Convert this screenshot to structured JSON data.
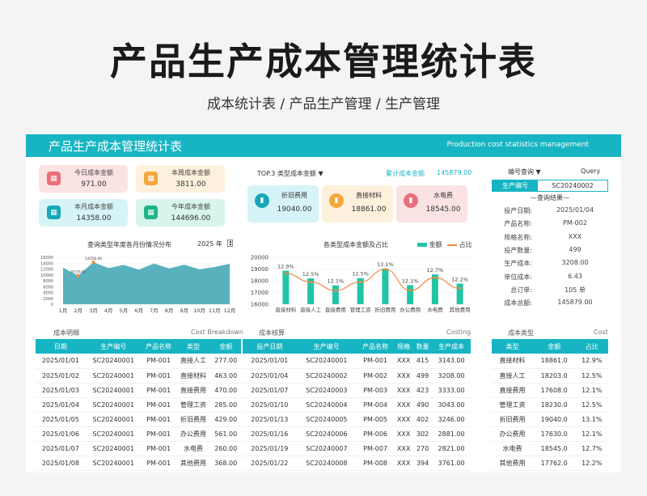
{
  "title": "产品生产成本管理统计表",
  "subtitle": "成本统计表 / 产品生产管理 / 生产管理",
  "banner": {
    "title": "产品生产成本管理统计表",
    "en": "Production cost statistics management"
  },
  "kpis": [
    {
      "label": "今日成本金额",
      "value": "971.00",
      "bg": "#fbe3e4",
      "icon_bg": "#e8707a",
      "icon": "calendar-icon"
    },
    {
      "label": "本周成本金额",
      "value": "3811.00",
      "bg": "#fdf0dd",
      "icon_bg": "#f5a83b",
      "icon": "calendar-icon"
    },
    {
      "label": "本月成本金额",
      "value": "14358.00",
      "bg": "#d6f4f7",
      "icon_bg": "#19a7b7",
      "icon": "chart-icon"
    },
    {
      "label": "今年成本金额",
      "value": "144696.00",
      "bg": "#d7f5ec",
      "icon_bg": "#1fb58a",
      "icon": "chart-icon"
    }
  ],
  "area_chart_header": {
    "label": "查询类型年度各月份情况分布",
    "year": "2025 年"
  },
  "top3_header": {
    "label": "TOP.3 类型成本金额 ▼",
    "total_label": "累计成本金额",
    "total_value": "145879.00"
  },
  "top3": [
    {
      "label": "折旧费用",
      "value": "19040.00",
      "bg": "#d6f4f7",
      "icon_bg": "#19a7b7"
    },
    {
      "label": "直接材料",
      "value": "18861.00",
      "bg": "#fdf0dd",
      "icon_bg": "#f5a83b"
    },
    {
      "label": "水电费",
      "value": "18545.00",
      "bg": "#fbe3e4",
      "icon_bg": "#e8707a"
    }
  ],
  "combo_header": {
    "label": "各类型成本金额及占比",
    "legend_amount": "金额",
    "legend_ratio": "占比"
  },
  "query": {
    "header": "编号查询 ▼",
    "header_en": "Query",
    "input_label": "生产编号",
    "input_value": "SC20240002",
    "result_title": "—查询结果—",
    "rows": [
      {
        "k": "投产日期:",
        "v": "2025/01/04"
      },
      {
        "k": "产品名称:",
        "v": "PM-002"
      },
      {
        "k": "规格名称:",
        "v": "XXX"
      },
      {
        "k": "投产数量:",
        "v": "499"
      },
      {
        "k": "生产成本:",
        "v": "3208.00"
      },
      {
        "k": "单位成本:",
        "v": "6.43"
      },
      {
        "k": "总订单:",
        "v": "105  单"
      },
      {
        "k": "成本总额:",
        "v": "145879.00"
      }
    ]
  },
  "detail": {
    "title": "成本明细",
    "title_en": "Cost Breakdown",
    "headers": [
      "日期",
      "生产编号",
      "产品名称",
      "类型",
      "金额"
    ],
    "rows": [
      [
        "2025/01/01",
        "SC20240001",
        "PM-001",
        "直接人工",
        "277.00"
      ],
      [
        "2025/01/02",
        "SC20240001",
        "PM-001",
        "直接材料",
        "463.00"
      ],
      [
        "2025/01/03",
        "SC20240001",
        "PM-001",
        "直接费用",
        "470.00"
      ],
      [
        "2025/01/04",
        "SC20240001",
        "PM-001",
        "管理工资",
        "285.00"
      ],
      [
        "2025/01/05",
        "SC20240001",
        "PM-001",
        "折旧费用",
        "429.00"
      ],
      [
        "2025/01/06",
        "SC20240001",
        "PM-001",
        "办公费用",
        "561.00"
      ],
      [
        "2025/01/07",
        "SC20240001",
        "PM-001",
        "水电费",
        "260.00"
      ],
      [
        "2025/01/08",
        "SC20240001",
        "PM-001",
        "其他费用",
        "368.00"
      ]
    ]
  },
  "costing": {
    "title": "成本核算",
    "title_en": "Costing",
    "headers": [
      "投产日期",
      "生产编号",
      "产品名称",
      "规格",
      "数量",
      "生产成本"
    ],
    "rows": [
      [
        "2025/01/01",
        "SC20240001",
        "PM-001",
        "XXX",
        "415",
        "3143.00"
      ],
      [
        "2025/01/04",
        "SC20240002",
        "PM-002",
        "XXX",
        "499",
        "3208.00"
      ],
      [
        "2025/01/07",
        "SC20240003",
        "PM-003",
        "XXX",
        "423",
        "3333.00"
      ],
      [
        "2025/01/10",
        "SC20240004",
        "PM-004",
        "XXX",
        "490",
        "3043.00"
      ],
      [
        "2025/01/13",
        "SC20240005",
        "PM-005",
        "XXX",
        "402",
        "3246.00"
      ],
      [
        "2025/01/16",
        "SC20240006",
        "PM-006",
        "XXX",
        "302",
        "2881.00"
      ],
      [
        "2025/01/19",
        "SC20240007",
        "PM-007",
        "XXX",
        "270",
        "2821.00"
      ],
      [
        "2025/01/22",
        "SC20240008",
        "PM-008",
        "XXX",
        "394",
        "3761.00"
      ]
    ]
  },
  "types": {
    "title": "成本类型",
    "title_en": "Cost",
    "headers": [
      "类型",
      "金额",
      "占比"
    ],
    "rows": [
      [
        "直接材料",
        "18861.0",
        "12.9%"
      ],
      [
        "直接人工",
        "18203.0",
        "12.5%"
      ],
      [
        "直接费用",
        "17608.0",
        "12.1%"
      ],
      [
        "管理工资",
        "18230.0",
        "12.5%"
      ],
      [
        "折旧费用",
        "19040.0",
        "13.1%"
      ],
      [
        "办公费用",
        "17630.0",
        "12.1%"
      ],
      [
        "水电费",
        "18545.0",
        "12.7%"
      ],
      [
        "其他费用",
        "17762.0",
        "12.2%"
      ]
    ]
  },
  "chart_data": [
    {
      "type": "area",
      "categories": [
        "1月",
        "2月",
        "3月",
        "4月",
        "5月",
        "6月",
        "7月",
        "8月",
        "9月",
        "10月",
        "11月",
        "12月"
      ],
      "values": [
        12500,
        9729,
        14358,
        12300,
        13400,
        11800,
        13900,
        12200,
        13500,
        11900,
        12700,
        13800
      ],
      "annotations": [
        {
          "x": "2月",
          "text": "9729.00"
        },
        {
          "x": "3月",
          "text": "14358.00"
        }
      ],
      "yticks": [
        "0",
        "2000",
        "4000",
        "6000",
        "8000",
        "10000",
        "12000",
        "14000",
        "16000"
      ],
      "ylim": [
        0,
        16000
      ]
    },
    {
      "type": "bar",
      "categories": [
        "直接材料",
        "直接人工",
        "直接费用",
        "管理工资",
        "折旧费用",
        "办公费用",
        "水电费",
        "其他费用"
      ],
      "series": [
        {
          "name": "金额",
          "values": [
            18861,
            18203,
            17608,
            18230,
            19040,
            17630,
            18545,
            17762
          ]
        },
        {
          "name": "占比",
          "values": [
            12.9,
            12.5,
            12.1,
            12.5,
            13.1,
            12.1,
            12.7,
            12.2
          ]
        }
      ],
      "labels": [
        "12.9%",
        "12.5%",
        "12.1%",
        "12.5%",
        "13.1%",
        "12.1%",
        "12.7%",
        "12.2%"
      ],
      "yticks": [
        "16000",
        "17000",
        "18000",
        "19000",
        "20000"
      ],
      "ylim": [
        16000,
        20000
      ]
    }
  ]
}
